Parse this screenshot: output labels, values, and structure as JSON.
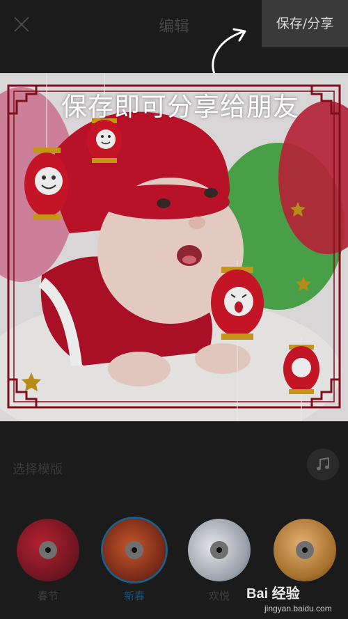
{
  "header": {
    "title": "编辑",
    "save_label": "保存/分享",
    "close_icon": "close-icon"
  },
  "preview": {
    "guide_text": "保存即可分享给朋友"
  },
  "templates": {
    "section_label": "选择模版",
    "music_icon": "music-note-icon",
    "items": [
      {
        "label": "春节",
        "selected": false
      },
      {
        "label": "新春",
        "selected": true
      },
      {
        "label": "欢悦",
        "selected": false
      },
      {
        "label": "",
        "selected": false
      }
    ]
  },
  "watermark": {
    "logo": "Bai 经验",
    "url": "jingyan.baidu.com"
  },
  "colors": {
    "background": "#1b1b1b",
    "save_button_bg": "#3a3a3a",
    "selected_ring": "#1d5f86"
  }
}
